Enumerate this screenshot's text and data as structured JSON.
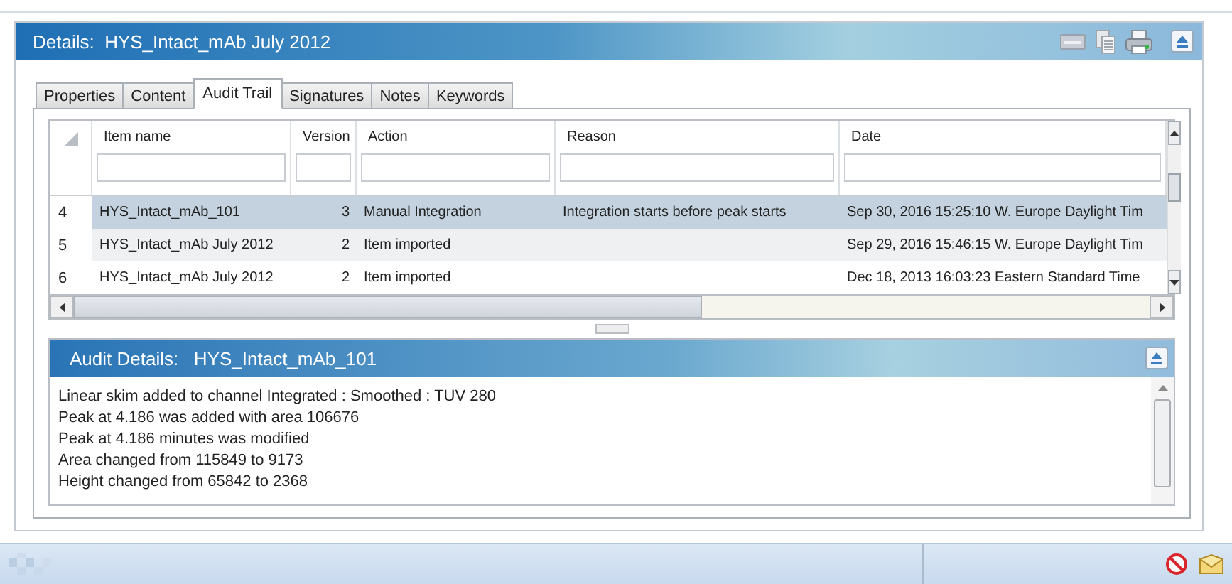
{
  "details": {
    "label": "Details:",
    "title": "HYS_Intact_mAb July 2012"
  },
  "tabs": [
    {
      "label": "Properties",
      "selected": false
    },
    {
      "label": "Content",
      "selected": false
    },
    {
      "label": "Audit Trail",
      "selected": true
    },
    {
      "label": "Signatures",
      "selected": false
    },
    {
      "label": "Notes",
      "selected": false
    },
    {
      "label": "Keywords",
      "selected": false
    }
  ],
  "table": {
    "columns": [
      "Item name",
      "Version",
      "Action",
      "Reason",
      "Date"
    ],
    "rows": [
      {
        "row_number": "4",
        "item_name": "HYS_Intact_mAb_101",
        "version": "3",
        "action": "Manual Integration",
        "reason": "Integration starts before peak starts",
        "date": "Sep 30, 2016 15:25:10 W. Europe Daylight Tim",
        "selected": true
      },
      {
        "row_number": "5",
        "item_name": "HYS_Intact_mAb July 2012",
        "version": "2",
        "action": "Item imported",
        "reason": "",
        "date": "Sep 29, 2016 15:46:15 W. Europe Daylight Tim",
        "selected": false
      },
      {
        "row_number": "6",
        "item_name": "HYS_Intact_mAb July 2012",
        "version": "2",
        "action": "Item imported",
        "reason": "",
        "date": "Dec 18, 2013 16:03:23 Eastern Standard Time",
        "selected": false
      }
    ]
  },
  "audit_details": {
    "label": "Audit Details:",
    "title": "HYS_Intact_mAb_101",
    "lines": [
      "Linear skim added to channel Integrated : Smoothed : TUV 280",
      "Peak at 4.186 was added with area 106676",
      "Peak at 4.186 minutes was modified",
      "Area changed from 115849 to 9173",
      "Height changed from 65842 to 2368"
    ]
  }
}
